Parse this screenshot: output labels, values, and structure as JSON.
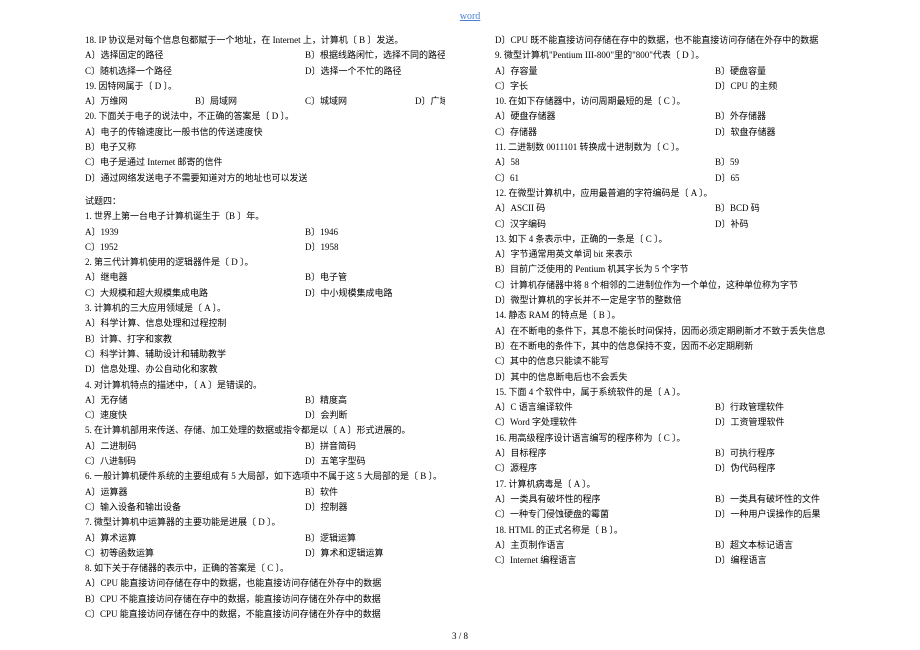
{
  "header": {
    "link": "word"
  },
  "footer": {
    "page": "3 / 8"
  },
  "col1": {
    "q18_stem": "18.  IP 协议是对每个信息包都赋于一个地址，在 Internet 上，计算机〔  B  〕发送。",
    "q18_a": "A〕选择固定的路径",
    "q18_b": "B〕根据线路闲忙，选择不同的路径",
    "q18_c": "C〕随机选择一个路径",
    "q18_d": "D〕选择一个不忙的路径",
    "q19_stem": "19.  因特网属于〔 D 〕。",
    "q19_a": "A〕万维网",
    "q19_b": "B〕局域网",
    "q19_c": "C〕城域网",
    "q19_d": "D〕广域网",
    "q20_stem": "20.  下面关于电子的说法中，不正确的答案是〔 D 〕。",
    "q20_a": "A〕电子的传输速度比一般书信的传送速度快",
    "q20_b": "B〕电子又称",
    "q20_c": "C〕电子是通过 Internet 邮寄的信件",
    "q20_d": "D〕通过网络发送电子不需要知道对方的地址也可以发送",
    "section4": "试题四：",
    "s4_1_stem": "1.  世界上第一台电子计算机诞生于〔B  〕年。",
    "s4_1_a": "A〕1939",
    "s4_1_b": "B〕1946",
    "s4_1_c": "C〕1952",
    "s4_1_d": "D〕1958",
    "s4_2_stem": "2.  第三代计算机使用的逻辑器件是〔  D 〕。",
    "s4_2_a": "A〕继电器",
    "s4_2_b": "B〕电子管",
    "s4_2_c": "C〕大规模和超大规模集成电路",
    "s4_2_d": "D〕中小规模集成电路",
    "s4_3_stem": "3.  计算机的三大应用领域是〔  A 〕。",
    "s4_3_a": "A〕科学计算、信息处理和过程控制",
    "s4_3_b": "B〕计算、打字和家教",
    "s4_3_c": "C〕科学计算、辅助设计和辅助教学",
    "s4_3_d": "D〕信息处理、办公自动化和家教",
    "s4_4_stem": "4.  对计算机特点的描述中，〔 A  〕是错误的。",
    "s4_4_a": "A〕无存储",
    "s4_4_b": "B〕精度高",
    "s4_4_c": "C〕速度快",
    "s4_4_d": "D〕会判断",
    "s4_5_stem": "5.  在计算机部用来传送、存储、加工处理的数据或指令都是以〔  A 〕形式进展的。",
    "s4_5_a": "A〕二进制码",
    "s4_5_b": "B〕拼音简码",
    "s4_5_c": "C〕八进制码",
    "s4_5_d": "D〕五笔字型码",
    "s4_6_stem": "6.  一般计算机硬件系统的主要组成有 5 大局部，如下选项中不属于这 5 大局部的是〔  B 〕。",
    "s4_6_a": "A〕运算器",
    "s4_6_b": "B〕软件",
    "s4_6_c": "C〕输入设备和输出设备",
    "s4_6_d": "D〕控制器",
    "s4_7_stem": "7.  微型计算机中运算器的主要功能是进展〔  D 〕。",
    "s4_7_a": "A〕算术运算",
    "s4_7_b": "B〕逻辑运算",
    "s4_7_c": "C〕初等函数运算",
    "s4_7_d": "D〕算术和逻辑运算",
    "s4_8_stem": "8.  如下关于存储器的表示中，正确的答案是〔  C 〕。",
    "s4_8_a": "A〕CPU 能直接访问存储在存中的数据，也能直接访问存储在外存中的数据"
  },
  "col2": {
    "s4_8_b": "B〕CPU 不能直接访问存储在存中的数据，能直接访问存储在外存中的数据",
    "s4_8_c": "C〕CPU 能直接访问存储在存中的数据，不能直接访问存储在外存中的数据",
    "s4_8_d": "D〕CPU 既不能直接访问存储在存中的数据，也不能直接访问存储在外存中的数据",
    "s4_9_stem": "9.  微型计算机\"Pentium III-800\"里的\"800\"代表〔  D 〕。",
    "s4_9_a": "A〕存容量",
    "s4_9_b": "B〕硬盘容量",
    "s4_9_c": "C〕字长",
    "s4_9_d": "D〕CPU 的主频",
    "s4_10_stem": "10.  在如下存储器中，访问周期最短的是〔 C 〕。",
    "s4_10_a": "A〕硬盘存储器",
    "s4_10_b": "B〕外存储器",
    "s4_10_c": "C〕存储器",
    "s4_10_d": "D〕软盘存储器",
    "s4_11_stem": "11.  二进制数 0011101 转换成十进制数为〔  C 〕。",
    "s4_11_a": "A〕58",
    "s4_11_b": "B〕59",
    "s4_11_c": "C〕61",
    "s4_11_d": "D〕65",
    "s4_12_stem": "12.  在微型计算机中，应用最普遍的字符编码是〔  A 〕。",
    "s4_12_a": "A〕ASCII 码",
    "s4_12_b": "B〕BCD 码",
    "s4_12_c": "C〕汉字编码",
    "s4_12_d": "D〕补码",
    "s4_13_stem": "13.  如下 4 条表示中，正确的一条是〔 C 〕。",
    "s4_13_a": "A〕字节通常用英文单词 bit 来表示",
    "s4_13_b": "B〕目前广泛使用的 Pentium 机其字长为 5 个字节",
    "s4_13_c": "C〕计算机存储器中将 8 个相邻的二进制位作为一个单位，这种单位称为字节",
    "s4_13_d": "D〕微型计算机的字长并不一定是字节的整数倍",
    "s4_14_stem": "14.  静态 RAM 的特点是〔 B  〕。",
    "s4_14_a": "A〕在不断电的条件下，其息不能长时间保持，因而必须定期刷新才不致于丢失信息",
    "s4_14_b": "B〕在不断电的条件下，其中的信息保持不变，因而不必定期刷新",
    "s4_14_c": "C〕其中的信息只能读不能写",
    "s4_14_d": "D〕其中的信息断电后也不会丢失",
    "s4_15_stem": "15.  下面 4 个软件中，属于系统软件的是〔  A 〕。",
    "s4_15_a": "A〕C 语言编译软件",
    "s4_15_b": "B〕行政管理软件",
    "s4_15_c": "C〕Word 字处理软件",
    "s4_15_d": "D〕工资管理软件",
    "s4_16_stem": "16.  用高级程序设计语言编写的程序称为〔  C 〕。",
    "s4_16_a": "A〕目标程序",
    "s4_16_b": "B〕可执行程序",
    "s4_16_c": "C〕源程序",
    "s4_16_d": "D〕伪代码程序",
    "s4_17_stem": "17.  计算机病毒是〔  A 〕。",
    "s4_17_a": "A〕一类具有破坏性的程序",
    "s4_17_b": "B〕一类具有破坏性的文件",
    "s4_17_c": "C〕一种专门侵蚀硬盘的霉菌",
    "s4_17_d": "D〕一种用户误操作的后果",
    "s4_18_stem": "18.  HTML 的正式名称是〔 B  〕。",
    "s4_18_a": "A〕主页制作语言",
    "s4_18_b": "B〕超文本标记语言",
    "s4_18_c": "C〕Internet 编程语言",
    "s4_18_d": "D〕编程语言"
  }
}
